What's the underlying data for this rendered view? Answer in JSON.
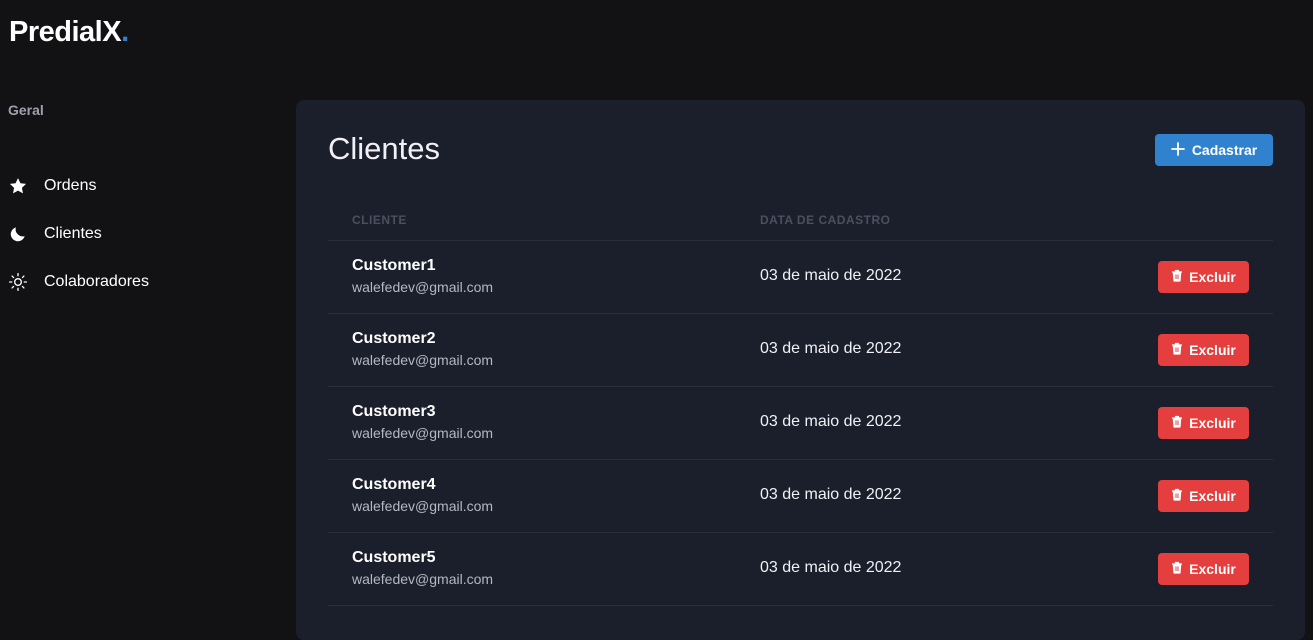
{
  "app": {
    "logo_text": "PredialX",
    "logo_dot": ".",
    "accent_color": "#3182ce",
    "danger_color": "#e53e3e"
  },
  "sidebar": {
    "section_label": "Geral",
    "items": [
      {
        "label": "Ordens",
        "icon": "star-icon"
      },
      {
        "label": "Clientes",
        "icon": "moon-icon"
      },
      {
        "label": "Colaboradores",
        "icon": "sun-icon"
      }
    ]
  },
  "main": {
    "title": "Clientes",
    "add_button_label": "Cadastrar",
    "table": {
      "headers": [
        "CLIENTE",
        "DATA DE CADASTRO"
      ],
      "delete_label": "Excluir",
      "rows": [
        {
          "name": "Customer1",
          "email": "walefedev@gmail.com",
          "date": "03 de maio de 2022"
        },
        {
          "name": "Customer2",
          "email": "walefedev@gmail.com",
          "date": "03 de maio de 2022"
        },
        {
          "name": "Customer3",
          "email": "walefedev@gmail.com",
          "date": "03 de maio de 2022"
        },
        {
          "name": "Customer4",
          "email": "walefedev@gmail.com",
          "date": "03 de maio de 2022"
        },
        {
          "name": "Customer5",
          "email": "walefedev@gmail.com",
          "date": "03 de maio de 2022"
        }
      ]
    }
  }
}
